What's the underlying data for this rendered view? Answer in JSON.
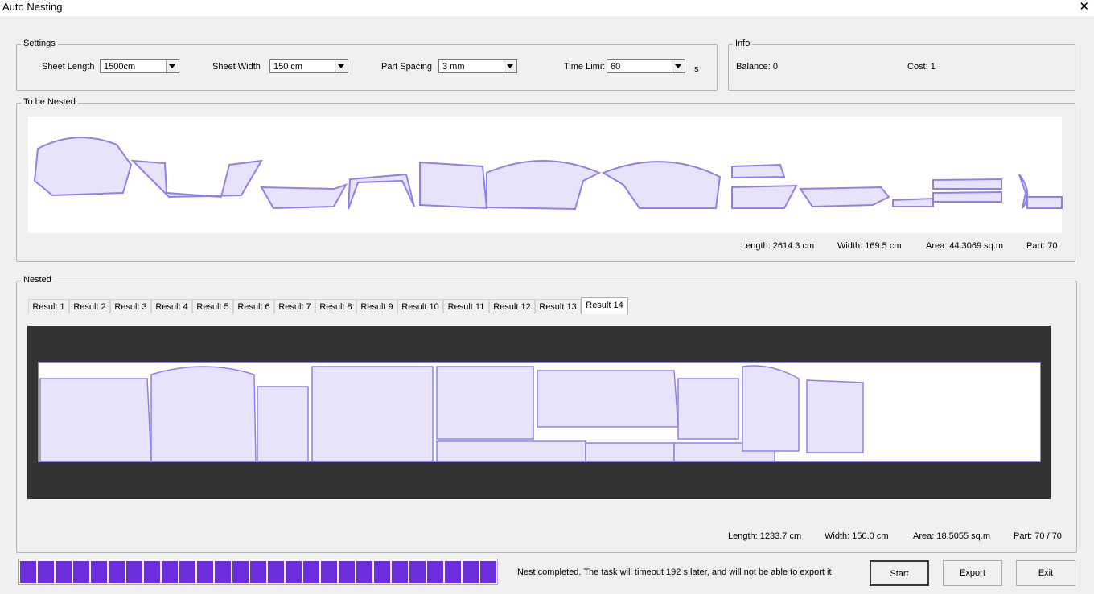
{
  "window": {
    "title": "Auto Nesting",
    "close": "✕"
  },
  "settings": {
    "legend": "Settings",
    "sheet_length_label": "Sheet Length",
    "sheet_length_value": "1500cm",
    "sheet_width_label": "Sheet Width",
    "sheet_width_value": "150 cm",
    "part_spacing_label": "Part Spacing",
    "part_spacing_value": "3 mm",
    "time_limit_label": "Time Limit",
    "time_limit_value": "60",
    "time_limit_unit": "s"
  },
  "info": {
    "legend": "Info",
    "balance": "Balance: 0",
    "cost": "Cost: 1"
  },
  "to_be_nested": {
    "legend": "To be Nested",
    "length": "Length: 2614.3 cm",
    "width": "Width: 169.5 cm",
    "area": "Area: 44.3069 sq.m",
    "parts": "Part: 70"
  },
  "nested": {
    "legend": "Nested",
    "tabs": [
      "Result 1",
      "Result 2",
      "Result 3",
      "Result 4",
      "Result 5",
      "Result 6",
      "Result 7",
      "Result 8",
      "Result 9",
      "Result 10",
      "Result 11",
      "Result 12",
      "Result 13",
      "Result 14"
    ],
    "active_tab": "Result 14",
    "length": "Length: 1233.7 cm",
    "width": "Width: 150.0 cm",
    "area": "Area: 18.5055 sq.m",
    "parts": "Part: 70 / 70"
  },
  "progress": {
    "value": 1.0,
    "color": "#6e2ddd"
  },
  "status": "Nest completed. The task will timeout 192 s later, and will not be able to export it",
  "buttons": {
    "start": "Start",
    "export": "Export",
    "exit": "Exit"
  },
  "colors": {
    "part_fill": "#e8e2fb",
    "part_stroke": "#8a84ea",
    "preview_bg": "#333333"
  }
}
